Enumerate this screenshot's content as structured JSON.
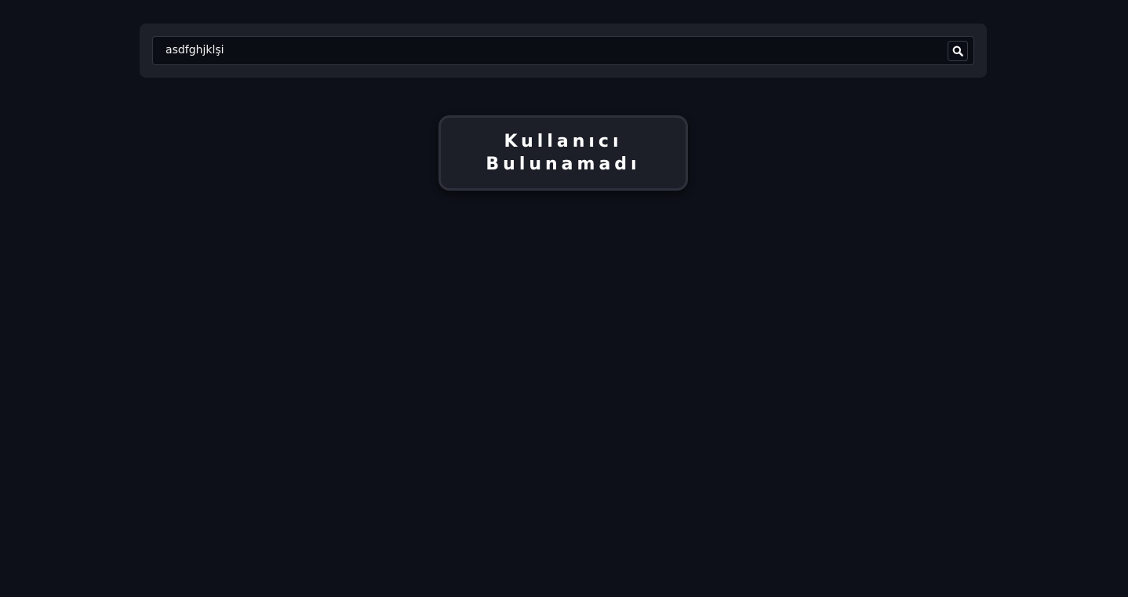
{
  "search": {
    "value": "asdfghjklşi",
    "button_icon": "search-icon"
  },
  "result": {
    "message": "Kullanıcı Bulunamadı"
  },
  "colors": {
    "background": "#0d1018",
    "panel": "#1e2029",
    "input_background": "#0b0d14",
    "card_background": "#1c1f28",
    "card_border": "#2e313c",
    "text": "#ffffff"
  }
}
